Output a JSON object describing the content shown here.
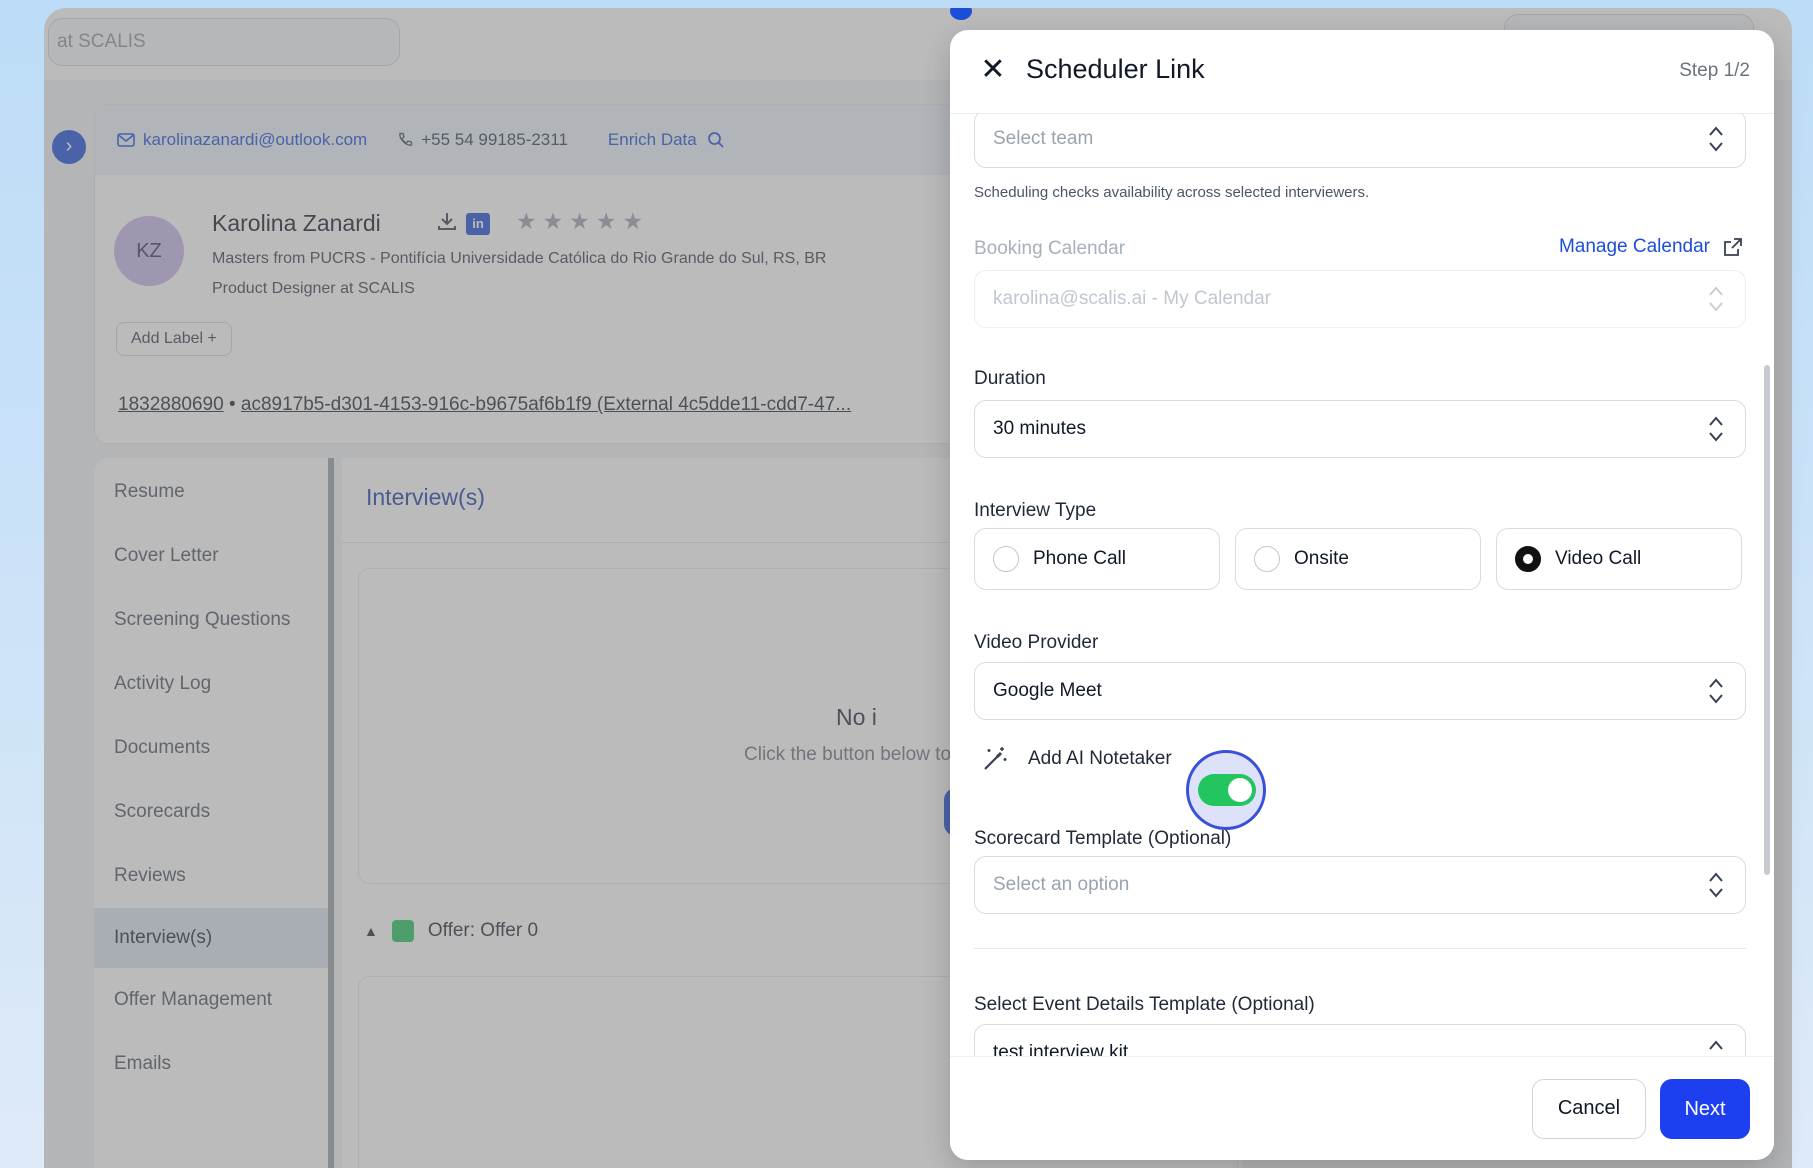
{
  "background": {
    "top_search_text": "at SCALIS",
    "contact": {
      "email": "karolinazanardi@outlook.com",
      "phone": "+55 54 99185-2311",
      "enrich_label": "Enrich Data"
    },
    "candidate": {
      "initials": "KZ",
      "name": "Karolina Zanardi",
      "linkedin": "in",
      "stars": "★★★★★",
      "education": "Masters from PUCRS - Pontifícia Universidade Católica do Rio Grande do Sul, RS, BR",
      "role": "Product Designer at SCALIS",
      "add_label": "Add Label  +"
    },
    "ids": {
      "first": "1832880690",
      "separator": " • ",
      "second": "ac8917b5-d301-4153-916c-b9675af6b1f9 (External 4c5dde11-cdd7-47..."
    },
    "nav": [
      {
        "label": "Resume"
      },
      {
        "label": "Cover Letter"
      },
      {
        "label": "Screening Questions"
      },
      {
        "label": "Activity Log"
      },
      {
        "label": "Documents"
      },
      {
        "label": "Scorecards"
      },
      {
        "label": "Reviews"
      },
      {
        "label": "Interview(s)",
        "active": true
      },
      {
        "label": "Offer Management"
      },
      {
        "label": "Emails"
      }
    ],
    "main": {
      "title": "Interview(s)",
      "empty_title": "No i",
      "empty_sub": "Click the button below to sc",
      "offer_label": "Offer: Offer 0"
    }
  },
  "modal": {
    "title": "Scheduler Link",
    "step": "Step 1/2",
    "team_placeholder": "Select team",
    "team_helper": "Scheduling checks availability across selected interviewers.",
    "booking_calendar_label": "Booking Calendar",
    "manage_calendar_label": "Manage Calendar",
    "booking_calendar_value": "karolina@scalis.ai - My Calendar",
    "duration_label": "Duration",
    "duration_value": "30 minutes",
    "interview_type_label": "Interview Type",
    "interview_types": [
      {
        "label": "Phone Call",
        "checked": false
      },
      {
        "label": "Onsite",
        "checked": false
      },
      {
        "label": "Video Call",
        "checked": true
      }
    ],
    "video_provider_label": "Video Provider",
    "video_provider_value": "Google Meet",
    "ai_notetaker_label": "Add AI Notetaker",
    "ai_notetaker_on": true,
    "scorecard_label": "Scorecard Template (Optional)",
    "scorecard_placeholder": "Select an option",
    "event_details_label": "Select Event Details Template (Optional)",
    "event_details_value": "test interview kit",
    "cancel_label": "Cancel",
    "next_label": "Next"
  },
  "colors": {
    "accent": "#1d4ed8",
    "next_button": "#1d3ff0",
    "toggle_on": "#22c55e",
    "offer_status": "#22c55e",
    "avatar": "#c7b6e8"
  },
  "icons": {
    "close": "close-icon",
    "updown": "chevron-updown-icon",
    "external": "external-link-icon",
    "wand": "magic-wand-icon",
    "email": "mail-icon",
    "phone": "phone-icon",
    "search": "search-icon",
    "download": "download-icon",
    "star": "star-icon",
    "expand": "chevron-right-icon"
  }
}
